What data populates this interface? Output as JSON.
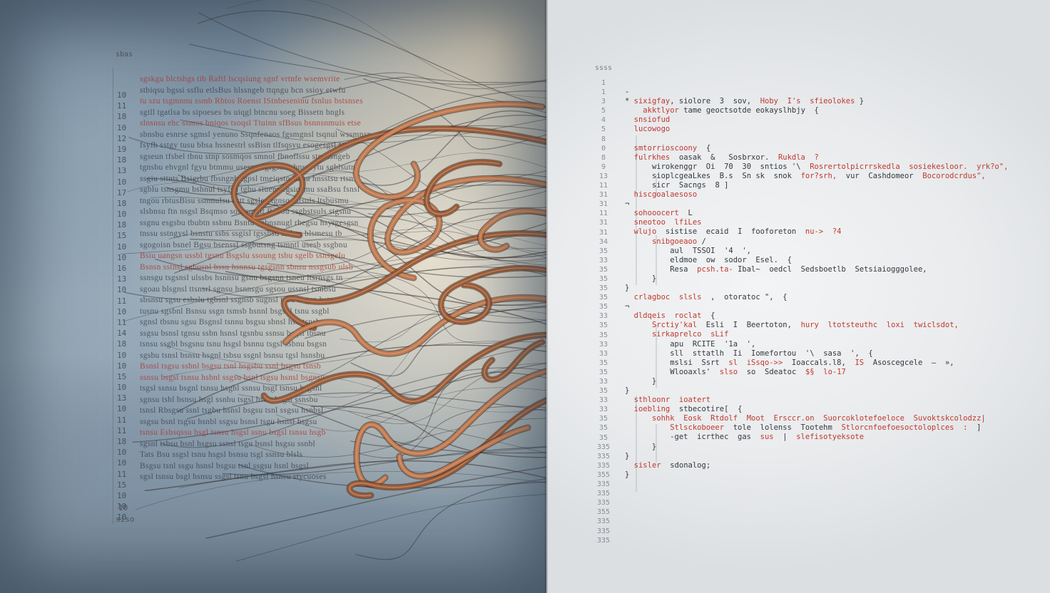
{
  "left_panel": {
    "corner_label": "sbas",
    "bottom_label": "siso",
    "bottom_num": "10",
    "line_numbers": [
      "10",
      "11",
      "18",
      "10",
      "12",
      "19",
      "18",
      "13",
      "10",
      "17",
      "18",
      "10",
      "18",
      "15",
      "10",
      "10",
      "16",
      "13",
      "10",
      "11",
      "10",
      "11",
      "14",
      "18",
      "10",
      "10",
      "15",
      "10",
      "13",
      "10",
      "11",
      "11",
      "18",
      "10",
      "10",
      "11",
      "15",
      "10",
      "10",
      "10"
    ],
    "rows": [
      {
        "text": "sgskgu  blctshgs  tib  Raftl  lscqsiung   sgnf   vrtnfe  wsemvrite",
        "red": true
      },
      {
        "text": "stbiqsu  bgssi  ssflu  etlsBus  hlssngeb  ttqngu  bcn  ssioy  etwfu",
        "red": false
      },
      {
        "text": "tu  szu  tsgmnnu  ssmb  Rbtos  Roenst  IStnbeseninu  fsnlus  bstsnses",
        "red": true
      },
      {
        "text": "sgtll  tgatlsa  bs  sipoeses  bs  uiqgl  btncnu  soeg  Bissetn  bngls",
        "red": false
      },
      {
        "text": "slnsnsu  ehc  ssmos  bniqos  tsoqsl  Ttuinn  sfBsus  bsnnsnmuis  etse",
        "red": true
      },
      {
        "text": "sbnsbu  esnrse  sgmsl  yenuno  Ssqnfenaos  fgsmgnsl  tsqnul  wssmnsn",
        "red": false
      },
      {
        "text": "fsyfb  sstgy  tusu  bbsa  hssnestrl  ssBisn  tlfsqsyu  esogesgsl  tsn",
        "red": false
      },
      {
        "text": "sgseun  tfsbel  tbnu  stnp  sosmqos  smnol  fbnoflssu  stnsosngeb",
        "red": false
      },
      {
        "text": "tgnsbu  ehvgnl  fgyu  btmmu  usesnu  fgfgsonr  hnsseytu  sgblsutn",
        "red": false
      },
      {
        "text": "ssgiu  sttnts  Bsigrbu  fbsngnb  tgpsl  tmeiqsto  Bnsu  hnsstsu  rtsn",
        "red": false
      },
      {
        "text": "sgblu  tsnsgmu  bshnul  tsyfsu  tgbu  siuenr  cgsiqsmu  ssaBsu  fsnsl",
        "red": false
      },
      {
        "text": "tngou  rbtusBisu  ssmnulsu  bstt  sgsleu  tgnsq  sstsuls  ltsbusmu",
        "red": false
      },
      {
        "text": "slsbnsu  ftn  nsgsl  Bsqmso  sosgsumlt  Rebou  ssgbstsuls  stgsnu",
        "red": false
      },
      {
        "text": "ssgnu  esgsbu  tbubtn  ssbnu  Bsntu  eqbnsnugl  rbegsu  hsyrgesgsn",
        "red": false
      },
      {
        "text": "tnssu  sstngysl  bsnstu  ssbs  ssgisl  tgssbsu  fstbsu  blsmesu  tb",
        "red": false
      },
      {
        "text": "sgogoisn  bsnel  Bgsu  bsenssl  ssgbutsng  tsmntl  usesb  ssgbnu",
        "red": false
      },
      {
        "text": "Bsiu  uangsn  ussbl  tgsnu  Bsgslu  ssoung  tsbu  sgelb  ssnsgelu",
        "red": true
      },
      {
        "text": "Bsnsn  sstnsl  sgbusnl  bssu  hsnnsu  tgsgsnn  sbnsu  nssgsub  ulsb",
        "red": true
      },
      {
        "text": "ssnsgu  tsgsnsl  ulssbs  hsnnsu  gsnu  bsgsnn  tsneu  ltsrnsgs  tn",
        "red": false
      },
      {
        "text": "sgoau  blsgnsl  ttsnsrl  sgnsu  hsnnsgu  sgsou  ussnsl  tsmbsu",
        "red": false
      },
      {
        "text": "sbsnsu  sgsu  esbslu  tgbsnl  ssgnsb  sugnsl  tsou  hsgsn  bstnu",
        "red": false
      },
      {
        "text": "tusnu  sgsbnl  Bsnsu  ssgn  tsmsb  hsnnl  bsgsnl  tsnu  ssgbl",
        "red": false
      },
      {
        "text": "sgnsl  tbsnu  sgsu  Bsgnsl  tsnnu  bsgsu  sbnsl  hsu  tsnsbu",
        "red": false
      },
      {
        "text": "ssgsu  bsnsl  tgnsu  ssbn  hsnsl  tgsnbu  ssnsu  bsgsl  tbsnu",
        "red": false
      },
      {
        "text": "tsnsu  ssgbl  bsgsnu  tsnu  hsgsl  bsnnu  tsgsl  ssbnu  bsgsn",
        "red": false
      },
      {
        "text": "sgsbu  tsnsl  bsnsu  hsgnl  tsbsu  ssgnl  bsnsu  tgsl  hsnsbu",
        "red": false
      },
      {
        "text": "Bsnsl  tsgsu  ssbnl  bsgsu  tsnl  hsgsbu  ssnl  bsgsu  tsnsb",
        "red": true
      },
      {
        "text": "ssnsu  bsgsl  tsnsu  hsbnl  ssgsu  bsnl  tsgsu  hsnsl  bsgnsu",
        "red": true
      },
      {
        "text": "tsgsl  ssnsu  bsgnl  tsnsu  hsgbl  ssnsu  bsgl  tsnsu  hsgsnl",
        "red": false
      },
      {
        "text": "sgnsu  tsbl  bsnsu  hsgl  ssnbu  tsgsl  bsnu  hsgsl  ssnsbu",
        "red": false
      },
      {
        "text": "tsnsl  Rbsgsu  ssnl  tsgbu  hsnsl  bsgsu  tsnl  ssgsu  hsnbsl",
        "red": false
      },
      {
        "text": "ssgsu  bsnl  tsgsu  hsnbl  ssgsu  bsnsl  tsgu  hsnsl  bsgsu",
        "red": false
      },
      {
        "text": "tsnsu  Esbsqssu  bsgl  tsnsu  hsgsl  ssnu  bsgsl  tsnsu  hsgb",
        "red": true
      },
      {
        "text": "sgsnl  tsbsu  bsnl  hsgsu  ssnsl  tsgu  bsnsl  hsgsu  ssnbl",
        "red": false
      },
      {
        "text": "Tats  Bsu  ssgsl  tsnu  hsgsl  bsnsu  tsgl  ssnsu  blsls",
        "red": false
      },
      {
        "text": "Bsgsu  tsnl  ssgu  hsnsl  bsgsu  tsnl  ssgsu  hsnl  bsgsl",
        "red": false
      },
      {
        "text": "sgsl  tsnsu  bsgl  hsnsu  ssgsl  tsnu  bsgsl  hsnsu  stycuoses",
        "red": false
      }
    ]
  },
  "right_panel": {
    "corner_label": "ssss",
    "line_numbers": [
      "1",
      "1",
      "3",
      "5",
      "4",
      "5",
      "8",
      "0",
      "8",
      "9",
      "13",
      "11",
      "31",
      "31",
      "11",
      "31",
      "31",
      "34",
      "35",
      "33",
      "35",
      "35",
      "35",
      "35",
      "35",
      "33",
      "35",
      "35",
      "33",
      "33",
      "35",
      "35",
      "33",
      "35",
      "33",
      "33",
      "35",
      "35",
      "35",
      "335",
      "335",
      "335",
      "355",
      "335",
      "335",
      "335",
      "355",
      "335",
      "335",
      "335"
    ],
    "code": [
      [
        {
          "t": "-",
          "c": "d"
        }
      ],
      [
        {
          "t": "* ",
          "c": "d"
        },
        {
          "t": "sixigfay",
          "c": "r"
        },
        {
          "t": ", ",
          "c": "d"
        },
        {
          "t": "siolore  3  sov,  ",
          "c": "d"
        },
        {
          "t": "Hoby  I's  ",
          "c": "r"
        },
        {
          "t": "sfieolokes",
          "c": "r"
        },
        {
          "t": " }",
          "c": "d"
        }
      ],
      [
        {
          "t": "    ",
          "c": "d"
        },
        {
          "t": "akktlyor",
          "c": "r"
        },
        {
          "t": " tame ",
          "c": "d"
        },
        {
          "t": "geoctsotde",
          "c": "d"
        },
        {
          "t": " eokayslhbjy  {",
          "c": "d"
        }
      ],
      [
        {
          "t": "  ",
          "c": "d"
        },
        {
          "t": "snsiofud",
          "c": "r"
        }
      ],
      [
        {
          "t": "  ",
          "c": "d"
        },
        {
          "t": "lucowogo",
          "c": "r"
        }
      ],
      [
        {
          "t": "",
          "c": "d"
        }
      ],
      [
        {
          "t": "  ",
          "c": "d"
        },
        {
          "t": "smtorrioscoony",
          "c": "r"
        },
        {
          "t": "  {",
          "c": "d"
        }
      ],
      [
        {
          "t": "  ",
          "c": "d"
        },
        {
          "t": "fulrkhes",
          "c": "r"
        },
        {
          "t": "  oasak  &   Sosbrxor.  ",
          "c": "d"
        },
        {
          "t": "Rukdla  ?",
          "c": "r"
        }
      ],
      [
        {
          "t": "      ",
          "c": "d"
        },
        {
          "t": "wirokenggr",
          "c": "d"
        },
        {
          "t": "  Oi  70  30  ",
          "c": "d"
        },
        {
          "t": "sntios '\\  ",
          "c": "d"
        },
        {
          "t": "Rosrertolpicrrskedla  sosiekesloor.",
          "c": "r"
        },
        {
          "t": "  ",
          "c": "d"
        },
        {
          "t": "yrk?o\",",
          "c": "r"
        }
      ],
      [
        {
          "t": "      ",
          "c": "d"
        },
        {
          "t": "sioplcgeaLkes  B.s  ",
          "c": "d"
        },
        {
          "t": "Sn sk  snok  ",
          "c": "d"
        },
        {
          "t": "for?srh,",
          "c": "r"
        },
        {
          "t": "  vur  Cashdomeor  ",
          "c": "d"
        },
        {
          "t": "Bocorodcrdus\",",
          "c": "r"
        }
      ],
      [
        {
          "t": "      ",
          "c": "d"
        },
        {
          "t": "sicr  Sacngs  8 ]",
          "c": "d"
        }
      ],
      [
        {
          "t": "  ",
          "c": "d"
        },
        {
          "t": "hiscgoalaesoso",
          "c": "r"
        }
      ],
      [
        {
          "t": "¬",
          "c": "d"
        }
      ],
      [
        {
          "t": "  ",
          "c": "d"
        },
        {
          "t": "sohooocert",
          "c": "r"
        },
        {
          "t": "  L",
          "c": "d"
        }
      ],
      [
        {
          "t": "  ",
          "c": "d"
        },
        {
          "t": "sneotoo  lfiLes",
          "c": "r"
        }
      ],
      [
        {
          "t": "  ",
          "c": "d"
        },
        {
          "t": "wlujo",
          "c": "r"
        },
        {
          "t": "  sistise  ecaid  ",
          "c": "d"
        },
        {
          "t": "I",
          "c": "d"
        },
        {
          "t": "  fooforeton  ",
          "c": "d"
        },
        {
          "t": "nu->  ?4",
          "c": "r"
        }
      ],
      [
        {
          "t": "      ",
          "c": "d"
        },
        {
          "t": "snibgoeaoo",
          "c": "r"
        },
        {
          "t": " /  ",
          "c": "d"
        }
      ],
      [
        {
          "t": "          ",
          "c": "d"
        },
        {
          "t": "aul  TSSOI  '4  ',",
          "c": "d"
        }
      ],
      [
        {
          "t": "          ",
          "c": "d"
        },
        {
          "t": "eldmoe  ow  sodor  Esel.  {",
          "c": "d"
        }
      ],
      [
        {
          "t": "          ",
          "c": "d"
        },
        {
          "t": "Resa  ",
          "c": "d"
        },
        {
          "t": "pcsh.ta-",
          "c": "r"
        },
        {
          "t": " ",
          "c": "d"
        },
        {
          "t": "Ibal~",
          "c": "d"
        },
        {
          "t": "  ",
          "c": "d"
        },
        {
          "t": "oedcl",
          "c": "d"
        },
        {
          "t": "  Sedsboetlb  Setsiaiogggolee,",
          "c": "d"
        }
      ],
      [
        {
          "t": "      }",
          "c": "d"
        }
      ],
      [
        {
          "t": "}",
          "c": "d"
        }
      ],
      [
        {
          "t": "  ",
          "c": "d"
        },
        {
          "t": "crlagboc  slsls",
          "c": "r"
        },
        {
          "t": "  ,  ",
          "c": "d"
        },
        {
          "t": "otoratoc \",",
          "c": "d"
        },
        {
          "t": "  {",
          "c": "d"
        }
      ],
      [
        {
          "t": "¬",
          "c": "d"
        }
      ],
      [
        {
          "t": "  ",
          "c": "d"
        },
        {
          "t": "dldqeis  roclat",
          "c": "r"
        },
        {
          "t": "  {",
          "c": "d"
        }
      ],
      [
        {
          "t": "      ",
          "c": "d"
        },
        {
          "t": "Srctiy'kal",
          "c": "r"
        },
        {
          "t": "  Esli  I  ",
          "c": "d"
        },
        {
          "t": "Beertoton,",
          "c": "d"
        },
        {
          "t": "  ",
          "c": "d"
        },
        {
          "t": "hury",
          "c": "r"
        },
        {
          "t": "  ",
          "c": "d"
        },
        {
          "t": "ltotsteuthc  ",
          "c": "r"
        },
        {
          "t": "loxi  twiclsdot,",
          "c": "r"
        }
      ],
      [
        {
          "t": "      ",
          "c": "d"
        },
        {
          "t": "sirkaprelco  sLif",
          "c": "r"
        }
      ],
      [
        {
          "t": "          ",
          "c": "d"
        },
        {
          "t": "apu  RCITE  ",
          "c": "d"
        },
        {
          "t": "'1a  ',",
          "c": "d"
        }
      ],
      [
        {
          "t": "          ",
          "c": "d"
        },
        {
          "t": "sll  sttatlh  ",
          "c": "d"
        },
        {
          "t": "Ii  ",
          "c": "d"
        },
        {
          "t": "Iomefortou",
          "c": "d"
        },
        {
          "t": "  '\\  ",
          "c": "d"
        },
        {
          "t": "sasa  ',",
          "c": "d"
        },
        {
          "t": "  {",
          "c": "d"
        }
      ],
      [
        {
          "t": "          ",
          "c": "d"
        },
        {
          "t": "mslsi  Ssrt  ",
          "c": "d"
        },
        {
          "t": "sl  iSsqo->>",
          "c": "r"
        },
        {
          "t": "  ",
          "c": "d"
        },
        {
          "t": "Ioaccals.l8,",
          "c": "d"
        },
        {
          "t": "  ",
          "c": "d"
        },
        {
          "t": "IS",
          "c": "r"
        },
        {
          "t": "  ",
          "c": "d"
        },
        {
          "t": "Asoscegcele",
          "c": "d"
        },
        {
          "t": "  –  »,",
          "c": "d"
        }
      ],
      [
        {
          "t": "          ",
          "c": "d"
        },
        {
          "t": "Wlooaxls'",
          "c": "d"
        },
        {
          "t": "  ",
          "c": "d"
        },
        {
          "t": "slso",
          "c": "r"
        },
        {
          "t": "  ",
          "c": "d"
        },
        {
          "t": "so  Sdeatoc",
          "c": "d"
        },
        {
          "t": "  ",
          "c": "d"
        },
        {
          "t": "$§",
          "c": "r"
        },
        {
          "t": "  ",
          "c": "d"
        },
        {
          "t": "lo-17",
          "c": "r"
        }
      ],
      [
        {
          "t": "      }",
          "c": "d"
        }
      ],
      [
        {
          "t": "}",
          "c": "d"
        }
      ],
      [
        {
          "t": "  ",
          "c": "d"
        },
        {
          "t": "sthloonr  ioatert",
          "c": "r"
        }
      ],
      [
        {
          "t": "  ",
          "c": "d"
        },
        {
          "t": "ioebling",
          "c": "r"
        },
        {
          "t": "  ",
          "c": "d"
        },
        {
          "t": "stbecotire[  {",
          "c": "d"
        }
      ],
      [
        {
          "t": "      ",
          "c": "d"
        },
        {
          "t": "sohhk  Eosk  Rtdolf  ",
          "c": "r"
        },
        {
          "t": "Moot  Ersccr.on  ",
          "c": "r"
        },
        {
          "t": "Suorcoklotefoeloce  Suvoktskcolodzz|",
          "c": "r"
        }
      ],
      [
        {
          "t": "          ",
          "c": "d"
        },
        {
          "t": "Stlsckoboeer",
          "c": "r"
        },
        {
          "t": "  tole  lolenss  ",
          "c": "d"
        },
        {
          "t": "Tootehm",
          "c": "d"
        },
        {
          "t": "  ",
          "c": "d"
        },
        {
          "t": "Stlorcnfoefoesoctoloplces  :",
          "c": "r"
        },
        {
          "t": "  ]",
          "c": "d"
        }
      ],
      [
        {
          "t": "          ",
          "c": "d"
        },
        {
          "t": "-get  icrthec  gas  ",
          "c": "d"
        },
        {
          "t": "sus",
          "c": "r"
        },
        {
          "t": "  |  ",
          "c": "d"
        },
        {
          "t": "slefisotyeksote",
          "c": "r"
        }
      ],
      [
        {
          "t": "      }",
          "c": "d"
        }
      ],
      [
        {
          "t": "}",
          "c": "d"
        }
      ],
      [
        {
          "t": "  ",
          "c": "d"
        },
        {
          "t": "sisler",
          "c": "r"
        },
        {
          "t": "  ",
          "c": "d"
        },
        {
          "t": "sdonalog;",
          "c": "d"
        }
      ],
      [
        {
          "t": "}",
          "c": "d"
        }
      ]
    ]
  },
  "colors": {
    "code_red": "#c0392f",
    "code_dark": "#34393e",
    "ribbon_copper": "#9a5a38",
    "ribbon_copper_light": "#c07a52"
  }
}
